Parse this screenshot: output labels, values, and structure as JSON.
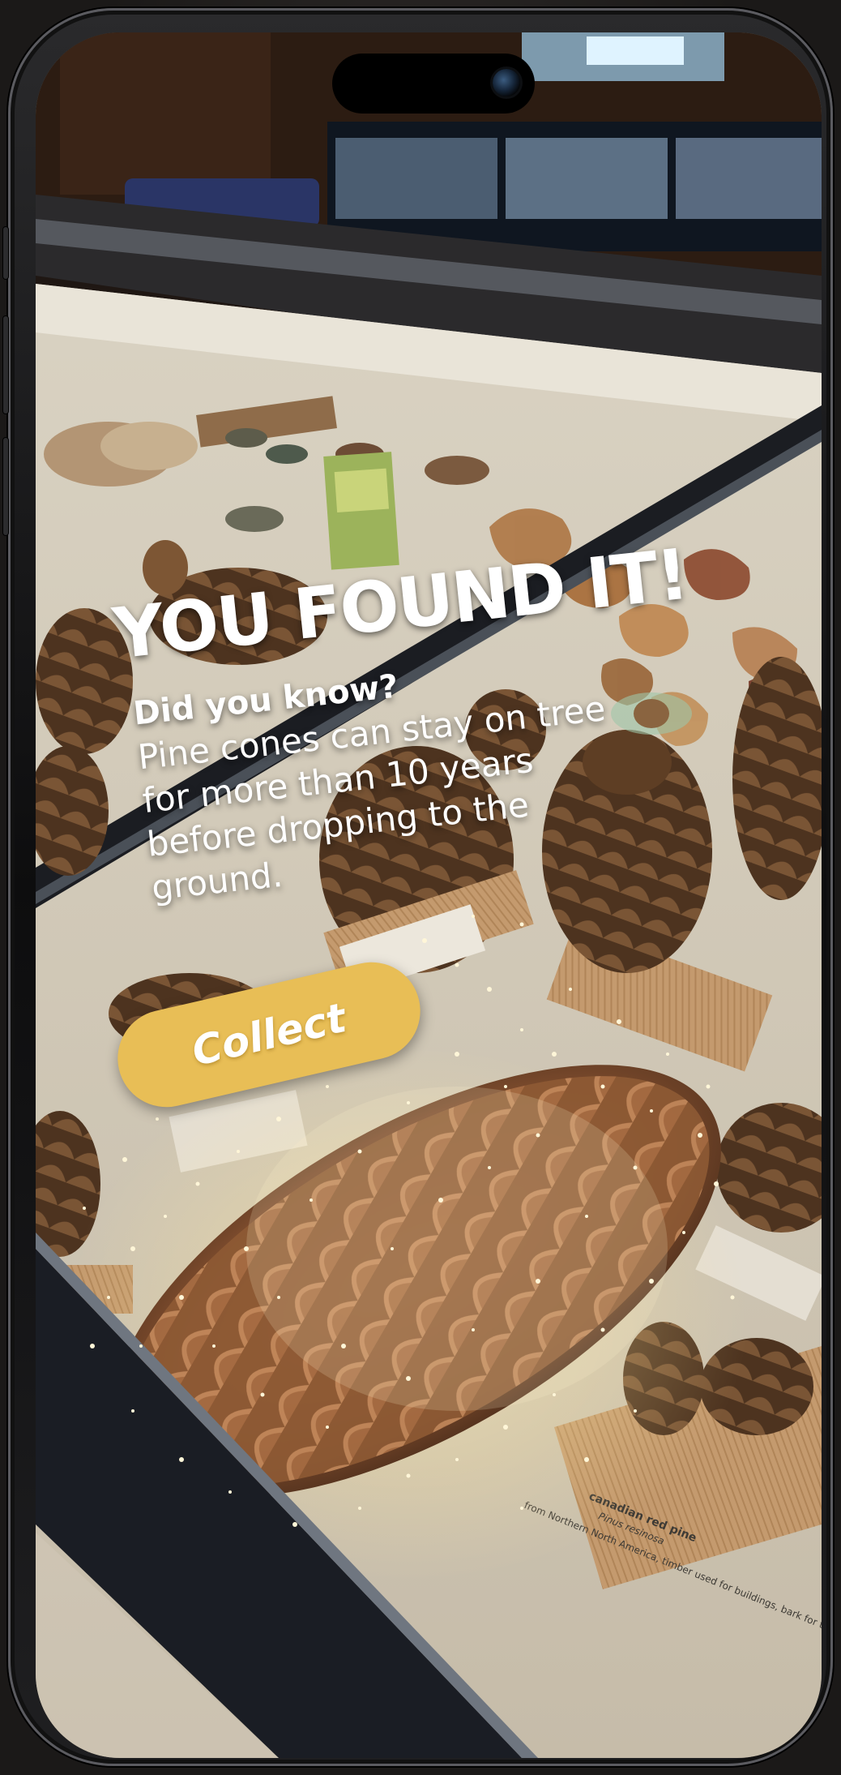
{
  "screen": {
    "headline": "YOU FOUND IT!",
    "question": "Did you know?",
    "fact": "Pine cones can stay on tree for more than 10 years before dropping to the ground.",
    "collect_label": "Collect"
  },
  "exhibit_label": {
    "title": "canadian red pine",
    "latin": "Pinus resinosa",
    "note": "from Northern North America, timber used for buildings, bark for tanning leather"
  },
  "colors": {
    "accent": "#E8BE56",
    "overlay_text": "#FFFFFF",
    "sparkle": "#FFF6D8"
  },
  "icons": {
    "camera": "front-camera-icon"
  }
}
